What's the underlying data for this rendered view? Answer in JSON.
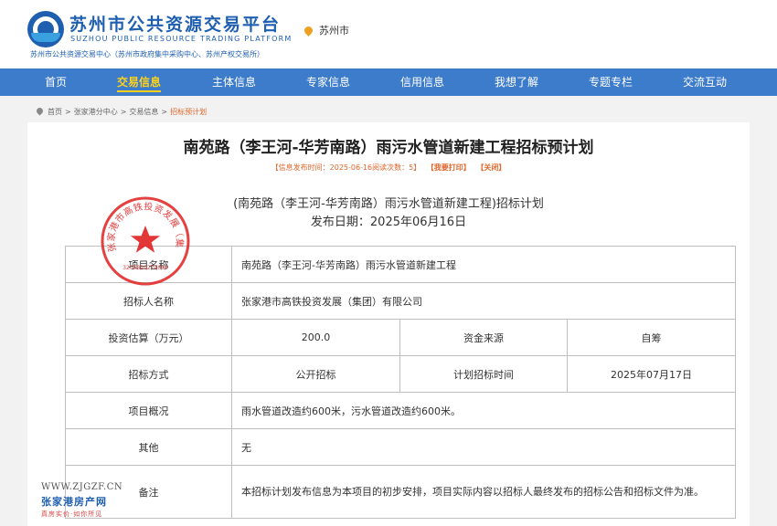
{
  "header": {
    "logo_title": "苏州市公共资源交易平台",
    "logo_subtitle": "SUZHOU PUBLIC RESOURCE TRADING PLATFORM",
    "logo_org": "苏州市公共资源交易中心（苏州市政府集中采购中心、苏州产权交易所）",
    "city": "苏州市"
  },
  "nav": {
    "items": [
      {
        "label": "首页"
      },
      {
        "label": "交易信息",
        "active": true
      },
      {
        "label": "主体信息"
      },
      {
        "label": "专家信息"
      },
      {
        "label": "信用信息"
      },
      {
        "label": "我想了解"
      },
      {
        "label": "专题专栏"
      },
      {
        "label": "交流互动"
      }
    ]
  },
  "breadcrumb": {
    "items": [
      "首页",
      "张家港分中心",
      "交易信息",
      "招标预计划"
    ],
    "separator": ">"
  },
  "article": {
    "title": "南苑路（李王河-华芳南路）雨污水管道新建工程招标预计划",
    "meta_info": "【信息发布时间：2025-06-16阅读次数：5】",
    "print_label": "【我要打印】",
    "close_label": "【关闭】",
    "subtitle": "(南苑路（李王河-华芳南路）雨污水管道新建工程)招标计划",
    "publish_date": "发布日期：2025年06月16日"
  },
  "table": {
    "project_name_label": "项目名称",
    "project_name": "南苑路（李王河-华芳南路）雨污水管道新建工程",
    "tenderer_label": "招标人名称",
    "tenderer": "张家港市高铁投资发展（集团）有限公司",
    "investment_label": "投资估算（万元）",
    "investment": "200.0",
    "fund_source_label": "资金来源",
    "fund_source": "自筹",
    "method_label": "招标方式",
    "method": "公开招标",
    "plan_time_label": "计划招标时间",
    "plan_time": "2025年07月17日",
    "overview_label": "项目概况",
    "overview": "雨水管道改造约600米，污水管道改造约600米。",
    "other_label": "其他",
    "other": "无",
    "remark_label": "备注",
    "remark": "本招标计划发布信息为本项目的初步安排，项目实际内容以招标人最终发布的招标公告和招标文件为准。"
  },
  "seal": {
    "text": "张家港市高铁投资发展（集团）有限公司",
    "number": "3205820274094",
    "color": "#e02020"
  },
  "watermark": {
    "url": "WWW.ZJGZF.CN",
    "name": "张家港房产网",
    "slogan": "真房实价·如你所见"
  },
  "colors": {
    "nav_bg": "#3d7ccb",
    "nav_active": "#ffd11a",
    "brand": "#1f5fb0",
    "meta_orange": "#e0662a"
  }
}
